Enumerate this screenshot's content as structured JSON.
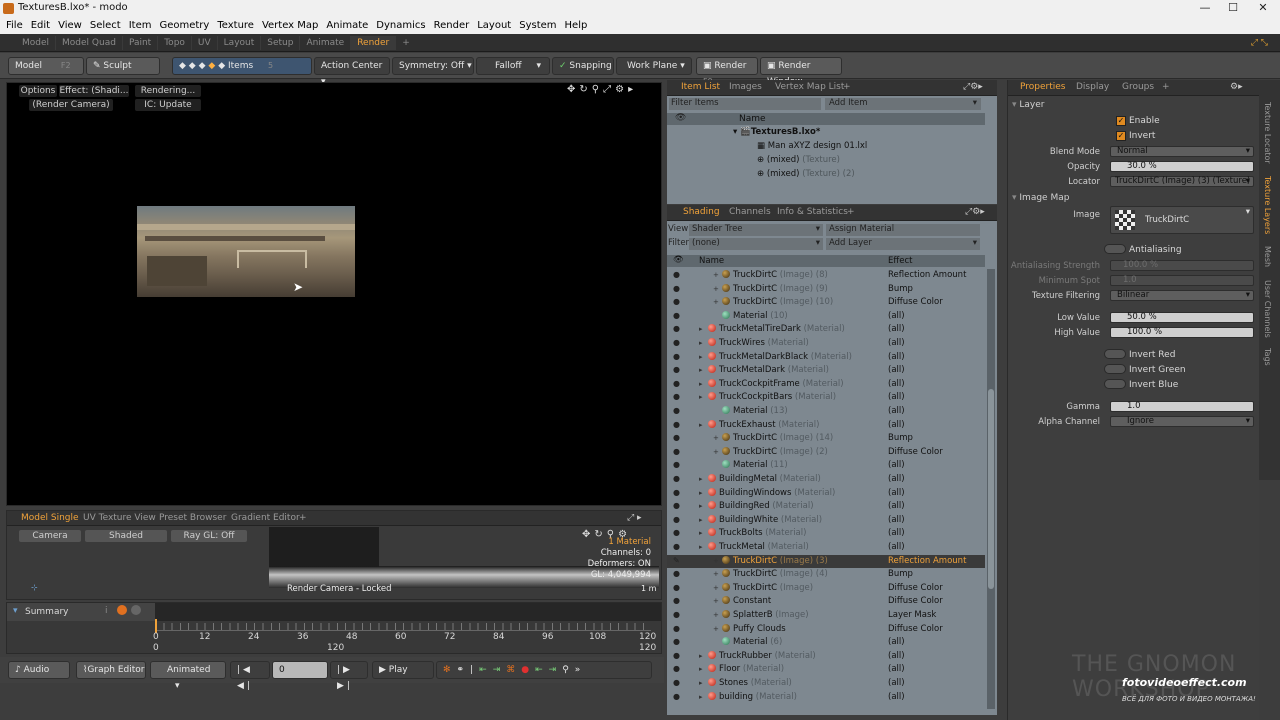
{
  "window": {
    "title": "TexturesB.lxo* - modo",
    "min": "—",
    "max": "☐",
    "close": "✕"
  },
  "menu": [
    "File",
    "Edit",
    "View",
    "Select",
    "Item",
    "Geometry",
    "Texture",
    "Vertex Map",
    "Animate",
    "Dynamics",
    "Render",
    "Layout",
    "System",
    "Help"
  ],
  "layout_tabs": [
    "Model",
    "Model Quad",
    "Paint",
    "Topo",
    "UV",
    "Layout",
    "Setup",
    "Animate",
    "Render",
    "+"
  ],
  "active_layout_tab": "Render",
  "toolbar": {
    "model": "Model",
    "model_key": "F2",
    "sculpt": "Sculpt",
    "items": "Items",
    "items_key": "5",
    "action_center": "Action Center",
    "symmetry": "Symmetry: Off",
    "falloff": "Falloff",
    "snapping": "Snapping",
    "work_plane": "Work Plane",
    "render": "Render",
    "render_key": "F9",
    "render_window": "Render Window"
  },
  "viewport": {
    "options": "Options",
    "effect": "Effect: (Shadi...",
    "rendering": "Rendering...",
    "camera": "(Render Camera)",
    "ic": "IC: Update"
  },
  "lower_viewport": {
    "tabs": [
      "Model Single",
      "UV Texture View",
      "Preset Browser",
      "Gradient Editor",
      "+"
    ],
    "camera": "Camera",
    "shaded": "Shaded",
    "raygl": "Ray GL: Off",
    "material": "1 Material",
    "channels": "Channels: 0",
    "deformers": "Deformers: ON",
    "gl": "GL: 4,049,994",
    "locked": "Render Camera - Locked",
    "scale": "1 m"
  },
  "timeline": {
    "summary": "Summary",
    "ticks": [
      "0",
      "12",
      "24",
      "36",
      "48",
      "60",
      "72",
      "84",
      "96",
      "108",
      "120"
    ],
    "bottom_ticks": [
      "0",
      "120",
      "120"
    ]
  },
  "transport": {
    "audio": "Audio",
    "graph_editor": "Graph Editor",
    "animated": "Animated",
    "frame": "0",
    "play": "Play"
  },
  "item_list": {
    "tabs": [
      "Item List",
      "Images",
      "Vertex Map List",
      "+"
    ],
    "filter": "Filter Items",
    "add_item": "Add Item",
    "col_name": "Name",
    "rows": [
      {
        "name": "TexturesB.lxo*",
        "sub": ""
      },
      {
        "name": "Man aXYZ design 01.lxl",
        "sub": ""
      },
      {
        "name": "(mixed)",
        "sub": "(Texture)"
      },
      {
        "name": "(mixed)",
        "sub": "(Texture) (2)"
      }
    ]
  },
  "shading": {
    "tabs": [
      "Shading",
      "Channels",
      "Info & Statistics",
      "+"
    ],
    "view_label": "View",
    "view_value": "Shader Tree",
    "assign_material": "Assign Material",
    "filter_label": "Filter",
    "filter_value": "(none)",
    "add_layer": "Add Layer",
    "col_name": "Name",
    "col_effect": "Effect",
    "rows": [
      {
        "indent": 2,
        "type": "i",
        "name": "TruckDirtC",
        "sub": "(Image) (8)",
        "effect": "Reflection Amount"
      },
      {
        "indent": 2,
        "type": "i",
        "name": "TruckDirtC",
        "sub": "(Image) (9)",
        "effect": "Bump"
      },
      {
        "indent": 2,
        "type": "i",
        "name": "TruckDirtC",
        "sub": "(Image) (10)",
        "effect": "Diffuse Color"
      },
      {
        "indent": 2,
        "type": "g",
        "name": "Material",
        "sub": "(10)",
        "effect": "(all)"
      },
      {
        "indent": 1,
        "type": "m",
        "name": "TruckMetalTireDark",
        "sub": "(Material)",
        "effect": "(all)"
      },
      {
        "indent": 1,
        "type": "m",
        "name": "TruckWires",
        "sub": "(Material)",
        "effect": "(all)"
      },
      {
        "indent": 1,
        "type": "m",
        "name": "TruckMetalDarkBlack",
        "sub": "(Material)",
        "effect": "(all)"
      },
      {
        "indent": 1,
        "type": "m",
        "name": "TruckMetalDark",
        "sub": "(Material)",
        "effect": "(all)"
      },
      {
        "indent": 1,
        "type": "m",
        "name": "TruckCockpitFrame",
        "sub": "(Material)",
        "effect": "(all)"
      },
      {
        "indent": 1,
        "type": "m",
        "name": "TruckCockpitBars",
        "sub": "(Material)",
        "effect": "(all)"
      },
      {
        "indent": 2,
        "type": "g",
        "name": "Material",
        "sub": "(13)",
        "effect": "(all)"
      },
      {
        "indent": 1,
        "type": "m",
        "name": "TruckExhaust",
        "sub": "(Material)",
        "effect": "(all)"
      },
      {
        "indent": 2,
        "type": "i",
        "name": "TruckDirtC",
        "sub": "(Image) (14)",
        "effect": "Bump"
      },
      {
        "indent": 2,
        "type": "i",
        "name": "TruckDirtC",
        "sub": "(Image) (2)",
        "effect": "Diffuse Color"
      },
      {
        "indent": 2,
        "type": "g",
        "name": "Material",
        "sub": "(11)",
        "effect": "(all)"
      },
      {
        "indent": 1,
        "type": "m",
        "name": "BuildingMetal",
        "sub": "(Material)",
        "effect": "(all)"
      },
      {
        "indent": 1,
        "type": "m",
        "name": "BuildingWindows",
        "sub": "(Material)",
        "effect": "(all)"
      },
      {
        "indent": 1,
        "type": "m",
        "name": "BuildingRed",
        "sub": "(Material)",
        "effect": "(all)"
      },
      {
        "indent": 1,
        "type": "m",
        "name": "BuildingWhite",
        "sub": "(Material)",
        "effect": "(all)"
      },
      {
        "indent": 1,
        "type": "m",
        "name": "TruckBolts",
        "sub": "(Material)",
        "effect": "(all)"
      },
      {
        "indent": 1,
        "type": "m",
        "name": "TruckMetal",
        "sub": "(Material)",
        "effect": "(all)"
      },
      {
        "indent": 2,
        "type": "i",
        "name": "TruckDirtC",
        "sub": "(Image) (3)",
        "effect": "Reflection Amount",
        "selected": true
      },
      {
        "indent": 2,
        "type": "i",
        "name": "TruckDirtC",
        "sub": "(Image) (4)",
        "effect": "Bump"
      },
      {
        "indent": 2,
        "type": "i",
        "name": "TruckDirtC",
        "sub": "(Image)",
        "effect": "Diffuse Color"
      },
      {
        "indent": 2,
        "type": "i",
        "name": "Constant",
        "sub": "",
        "effect": "Diffuse Color"
      },
      {
        "indent": 2,
        "type": "i",
        "name": "SplatterB",
        "sub": "(Image)",
        "effect": "Layer Mask"
      },
      {
        "indent": 2,
        "type": "i",
        "name": "Puffy Clouds",
        "sub": "",
        "effect": "Diffuse Color"
      },
      {
        "indent": 2,
        "type": "g",
        "name": "Material",
        "sub": "(6)",
        "effect": "(all)"
      },
      {
        "indent": 1,
        "type": "m",
        "name": "TruckRubber",
        "sub": "(Material)",
        "effect": "(all)"
      },
      {
        "indent": 1,
        "type": "m",
        "name": "Floor",
        "sub": "(Material)",
        "effect": "(all)"
      },
      {
        "indent": 1,
        "type": "m",
        "name": "Stones",
        "sub": "(Material)",
        "effect": "(all)"
      },
      {
        "indent": 1,
        "type": "m",
        "name": "building",
        "sub": "(Material)",
        "effect": "(all)"
      }
    ]
  },
  "properties": {
    "tabs": [
      "Properties",
      "Display",
      "Groups",
      "+"
    ],
    "layer_section": "Layer",
    "enable": "Enable",
    "invert": "Invert",
    "blend_mode_label": "Blend Mode",
    "blend_mode": "Normal",
    "opacity_label": "Opacity",
    "opacity": "30.0 %",
    "locator_label": "Locator",
    "locator": "TruckDirtC (Image) (3) (Texture)",
    "image_map_section": "Image Map",
    "image_label": "Image",
    "image": "TruckDirtC",
    "antialiasing": "Antialiasing",
    "aa_strength_label": "Antialiasing Strength",
    "aa_strength": "100.0 %",
    "min_spot_label": "Minimum Spot",
    "min_spot": "1.0",
    "tex_filter_label": "Texture Filtering",
    "tex_filter": "Bilinear",
    "low_value_label": "Low Value",
    "low_value": "50.0 %",
    "high_value_label": "High Value",
    "high_value": "100.0 %",
    "invert_red": "Invert Red",
    "invert_green": "Invert Green",
    "invert_blue": "Invert Blue",
    "gamma_label": "Gamma",
    "gamma": "1.0",
    "alpha_label": "Alpha Channel",
    "alpha": "Ignore"
  },
  "side_tabs": [
    "Texture Locator",
    "Texture Layers",
    "Mesh",
    "User Channels",
    "Tags"
  ],
  "watermark": {
    "gnomon": "THE GNOMON WORKSHOP",
    "site": "fotovideoeffect.com",
    "caption": "ВСЁ ДЛЯ ФОТО И ВИДЕО МОНТАЖА!"
  }
}
